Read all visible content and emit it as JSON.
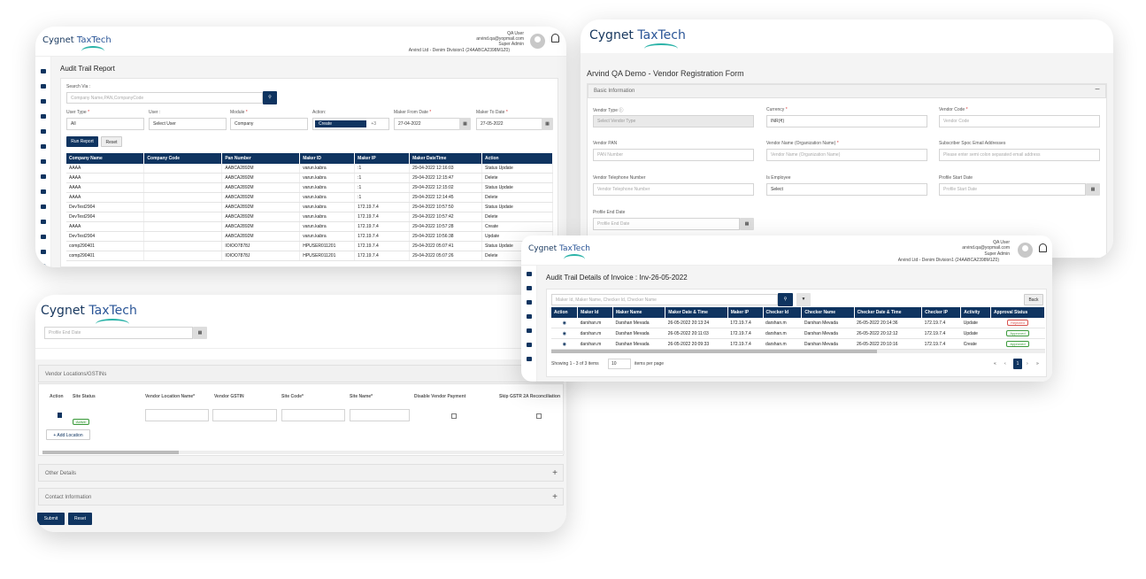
{
  "audit_report": {
    "logo": {
      "word1": "Cygnet",
      "word2": "TaxTech"
    },
    "user": {
      "name": "QA User",
      "email": "arvind.qa@yopmail.com",
      "role": "Super Admin",
      "org": "Arvind Ltd - Denim Division1 (24AABCA2398M1Z0)"
    },
    "title": "Audit Trail Report",
    "search_via_label": "Search Via :",
    "search_placeholder": "Company Name,PAN,CompanyCode",
    "filters": {
      "user_type_label": "User Type",
      "user_type_value": "All",
      "user_label": "User :",
      "user_value": "Select User",
      "module_label": "Module",
      "module_value": "Company",
      "action_label": "Action:",
      "action_chip": "Create",
      "action_more": "+3",
      "from_label": "Maker From Date",
      "from_value": "27-04-2022",
      "to_label": "Maker To Date",
      "to_value": "27-05-2022"
    },
    "run_button": "Run Report",
    "reset_button": "Reset",
    "columns": [
      "Company Name",
      "Company Code",
      "Pan Number",
      "Maker ID",
      "Maker IP",
      "Maker DateTime",
      "Action"
    ],
    "rows": [
      [
        "AAAA",
        "",
        "AABCA2892M",
        "varun.kabra",
        ":1",
        "29-04-2022 12:16:03",
        "Status Update"
      ],
      [
        "AAAA",
        "",
        "AABCA2892M",
        "varun.kabra",
        ":1",
        "29-04-2022 12:15:47",
        "Delete"
      ],
      [
        "AAAA",
        "",
        "AABCA2892M",
        "varun.kabra",
        ":1",
        "29-04-2022 12:15:02",
        "Status Update"
      ],
      [
        "AAAA",
        "",
        "AABCA2892M",
        "varun.kabra",
        ":1",
        "29-04-2022 12:14:45",
        "Delete"
      ],
      [
        "DevTest2904",
        "",
        "AABCA2892M",
        "varun.kabra",
        "172.19.7.4",
        "29-04-2022 10:57:50",
        "Status Update"
      ],
      [
        "DevTest2904",
        "",
        "AABCA2892M",
        "varun.kabra",
        "172.19.7.4",
        "29-04-2022 10:57:42",
        "Delete"
      ],
      [
        "AAAA",
        "",
        "AABCA2892M",
        "varun.kabra",
        "172.19.7.4",
        "29-04-2022 10:57:28",
        "Create"
      ],
      [
        "DevTest2904",
        "",
        "AABCA2892M",
        "varun.kabra",
        "172.19.7.4",
        "29-04-2022 10:56:38",
        "Update"
      ],
      [
        "comp290401",
        "",
        "IOIOO7878J",
        "HPUSER011201",
        "172.19.7.4",
        "29-04-2022 05:07:41",
        "Status Update"
      ],
      [
        "comp290401",
        "",
        "IOIOO7878J",
        "HPUSER011201",
        "172.19.7.4",
        "29-04-2022 05:07:26",
        "Delete"
      ]
    ]
  },
  "vendor_form": {
    "logo": {
      "word1": "Cygnet",
      "word2": "TaxTech"
    },
    "title": "Arvind QA Demo - Vendor Registration Form",
    "section": "Basic Information",
    "collapse": "−",
    "vendor_type_label": "Vendor Type",
    "vendor_type_value": "Select Vendor Type",
    "currency_label": "Currency",
    "currency_value": "INR(₹)",
    "vendor_code_label": "Vendor Code",
    "vendor_code_ph": "Vendor Code",
    "vendor_pan_label": "Vendor PAN",
    "vendor_pan_ph": "PAN Number",
    "vendor_name_label": "Vendor Name (Organization Name)",
    "vendor_name_ph": "Vendor Name (Organization Name)",
    "email_label": "Subscriber Spoc Email Addresses",
    "email_ph": "Please enter semi colon separated email address",
    "phone_label": "Vendor Telephone Number",
    "phone_ph": "Vendor Telephone Number",
    "employee_label": "Is Employee",
    "employee_value": "Select",
    "start_label": "Profile Start Date",
    "start_ph": "Profile Start Date",
    "end_label": "Profile End Date",
    "end_ph": "Profile End Date"
  },
  "vendor_locations": {
    "logo": {
      "word1": "Cygnet",
      "word2": "TaxTech"
    },
    "end_ph": "Profile End Date",
    "section": "Vendor Locations/GSTINs",
    "columns": [
      "Action",
      "Site Status",
      "Vendor Location Name*",
      "Vendor GSTIN",
      "Site Code*",
      "Site Name*",
      "Disable Vendor Payment",
      "Skip GSTR 2A Reconciliation"
    ],
    "status": "Active",
    "add_location": "Add Location",
    "other_details": "Other Details",
    "contact_info": "Contact Information",
    "submit": "Submit",
    "reset": "Reset"
  },
  "invoice_audit": {
    "logo": {
      "word1": "Cygnet",
      "word2": "TaxTech"
    },
    "user": {
      "name": "QA User",
      "email": "arvind.qa@yopmail.com",
      "role": "Super Admin",
      "org": "Arvind Ltd - Denim Division1 (24AABCA2398M1Z0)"
    },
    "title": "Audit Trail Details of Invoice : Inv-26-05-2022",
    "search_placeholder": "Maker Id, Maker Name, Checker Id, Checker Name",
    "back": "Back",
    "columns": [
      "Action",
      "Maker Id",
      "Maker Name",
      "Maker Date & Time",
      "Maker IP",
      "Checker Id",
      "Checker Name",
      "Checker Date & Time",
      "Checker IP",
      "Activity",
      "Approval Status"
    ],
    "rows": [
      [
        "darshan.m",
        "Darshan Mevada",
        "26-05-2022 20:13:24",
        "172.19.7.4",
        "darshan.m",
        "Darshan Mevada",
        "26-05-2022 20:14:36",
        "172.19.7.4",
        "Update",
        "Rejected"
      ],
      [
        "darshan.m",
        "Darshan Mevada",
        "26-05-2022 20:11:03",
        "172.19.7.4",
        "darshan.m",
        "Darshan Mevada",
        "26-05-2022 20:12:12",
        "172.19.7.4",
        "Update",
        "Approved"
      ],
      [
        "darshan.m",
        "Darshan Mevada",
        "26-05-2022 20:09:33",
        "172.19.7.4",
        "darshan.m",
        "Darshan Mevada",
        "26-05-2022 20:10:16",
        "172.19.7.4",
        "Create",
        "Approved"
      ]
    ],
    "showing": "Showing 1 - 3 of 3 items",
    "page_size": "10",
    "per_page": "items per page",
    "page": "1",
    "status_colors": {
      "Rejected": "#d9534f",
      "Approved": "#3c9a3c"
    }
  },
  "colors": {
    "primary": "#0f3460",
    "teal": "#2bb3a8"
  }
}
